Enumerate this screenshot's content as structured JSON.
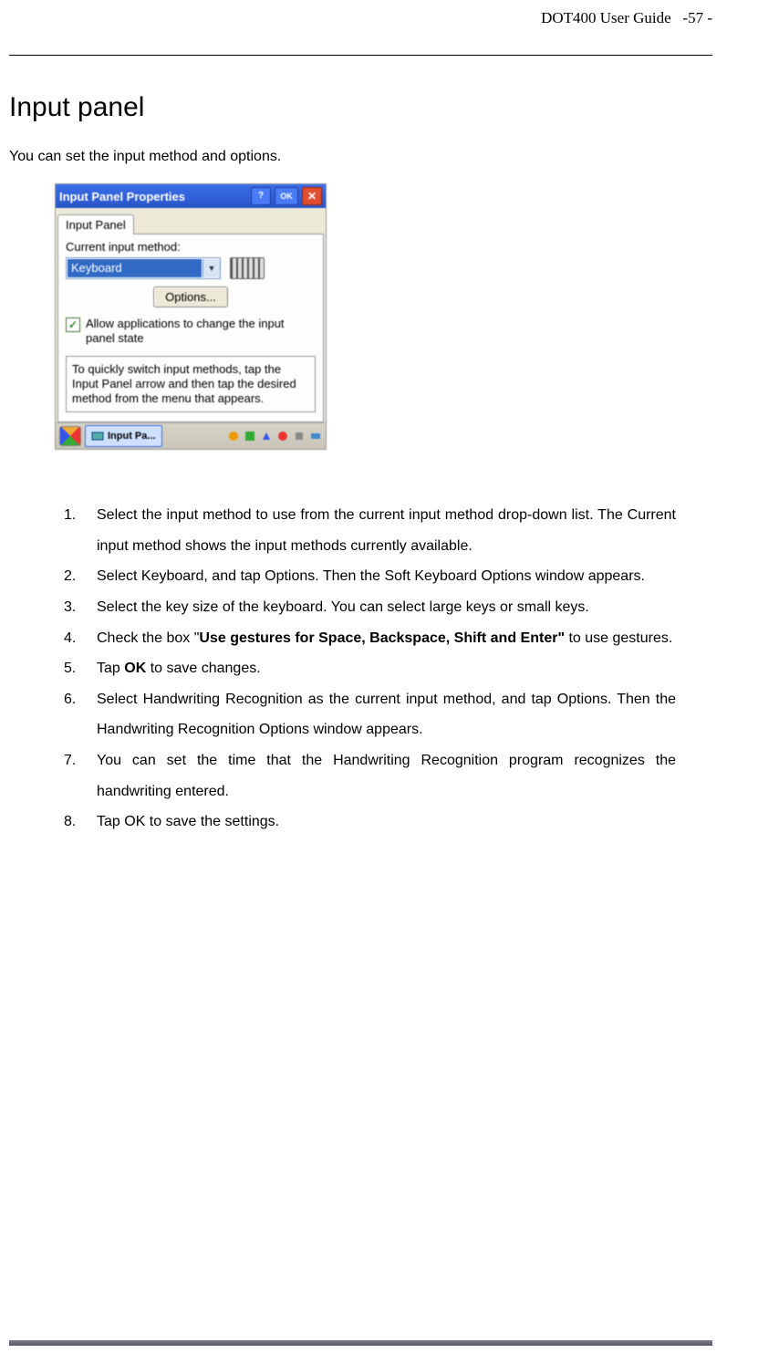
{
  "header": {
    "book": "DOT400 User Guide",
    "page": "-57 -"
  },
  "section": {
    "title": "Input panel",
    "intro": "You can set the input method and options."
  },
  "shot": {
    "title": "Input Panel Properties",
    "help": "?",
    "ok": "OK",
    "close": "✕",
    "tab": "Input Panel",
    "label_current": "Current input method:",
    "dropdown": "Keyboard",
    "options_btn": "Options...",
    "checkbox_text": "Allow applications to change the input panel state",
    "tip": "To quickly switch input methods, tap the Input Panel arrow and then tap the desired method from the menu that appears.",
    "taskbtn": "Input Pa..."
  },
  "steps": [
    {
      "text": "Select the input method to use from the current input method drop-down list. The Current input method shows the input methods currently available."
    },
    {
      "text": "Select Keyboard, and tap Options. Then the Soft Keyboard Options window appears."
    },
    {
      "text": "Select the key size of the keyboard. You can select large keys or small keys."
    },
    {
      "pre": "Check the box \"",
      "bold": "Use gestures for Space, Backspace, Shift and Enter\"",
      "post": " to use gestures."
    },
    {
      "pre": "Tap ",
      "bold": "OK",
      "post": " to save changes."
    },
    {
      "text": "Select Handwriting Recognition as the current input method, and tap Options. Then the Handwriting Recognition Options window appears."
    },
    {
      "text": "You can set the time that the Handwriting Recognition program recognizes the handwriting entered."
    },
    {
      "text": "Tap OK to save the settings."
    }
  ]
}
